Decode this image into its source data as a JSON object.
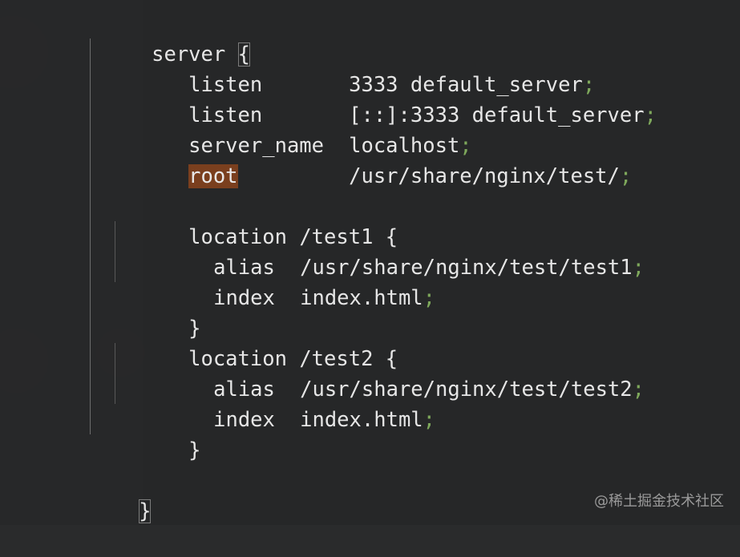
{
  "editor": {
    "lines": {
      "l1": {
        "key": "server",
        "brace": "{"
      },
      "l2": {
        "key": "listen",
        "value": "3333 default_server",
        "semi": ";"
      },
      "l3": {
        "key": "listen",
        "value": "[::]:3333 default_server",
        "semi": ";"
      },
      "l4": {
        "key": "server_name",
        "value": "localhost",
        "semi": ";"
      },
      "l5": {
        "key": "root",
        "value": "/usr/share/nginx/test/",
        "semi": ";"
      },
      "l7": {
        "key": "location",
        "path": "/test1",
        "brace": "{"
      },
      "l8": {
        "key": "alias",
        "value": "/usr/share/nginx/test/test1",
        "semi": ";"
      },
      "l9": {
        "key": "index",
        "value": "index.html",
        "semi": ";"
      },
      "l10": {
        "brace": "}"
      },
      "l11": {
        "key": "location",
        "path": "/test2",
        "brace": "{"
      },
      "l12": {
        "key": "alias",
        "value": "/usr/share/nginx/test/test2",
        "semi": ";"
      },
      "l13": {
        "key": "index",
        "value": "index.html",
        "semi": ";"
      },
      "l14": {
        "brace": "}"
      },
      "l16": {
        "brace": "}"
      }
    },
    "colors": {
      "background": "#262728",
      "text": "#e2e2e2",
      "semicolon": "#7ea85b",
      "highlight": "#7a3f1e",
      "indent_guide": "#6d6d6d"
    }
  },
  "watermark": {
    "text": "@稀土掘金技术社区"
  }
}
